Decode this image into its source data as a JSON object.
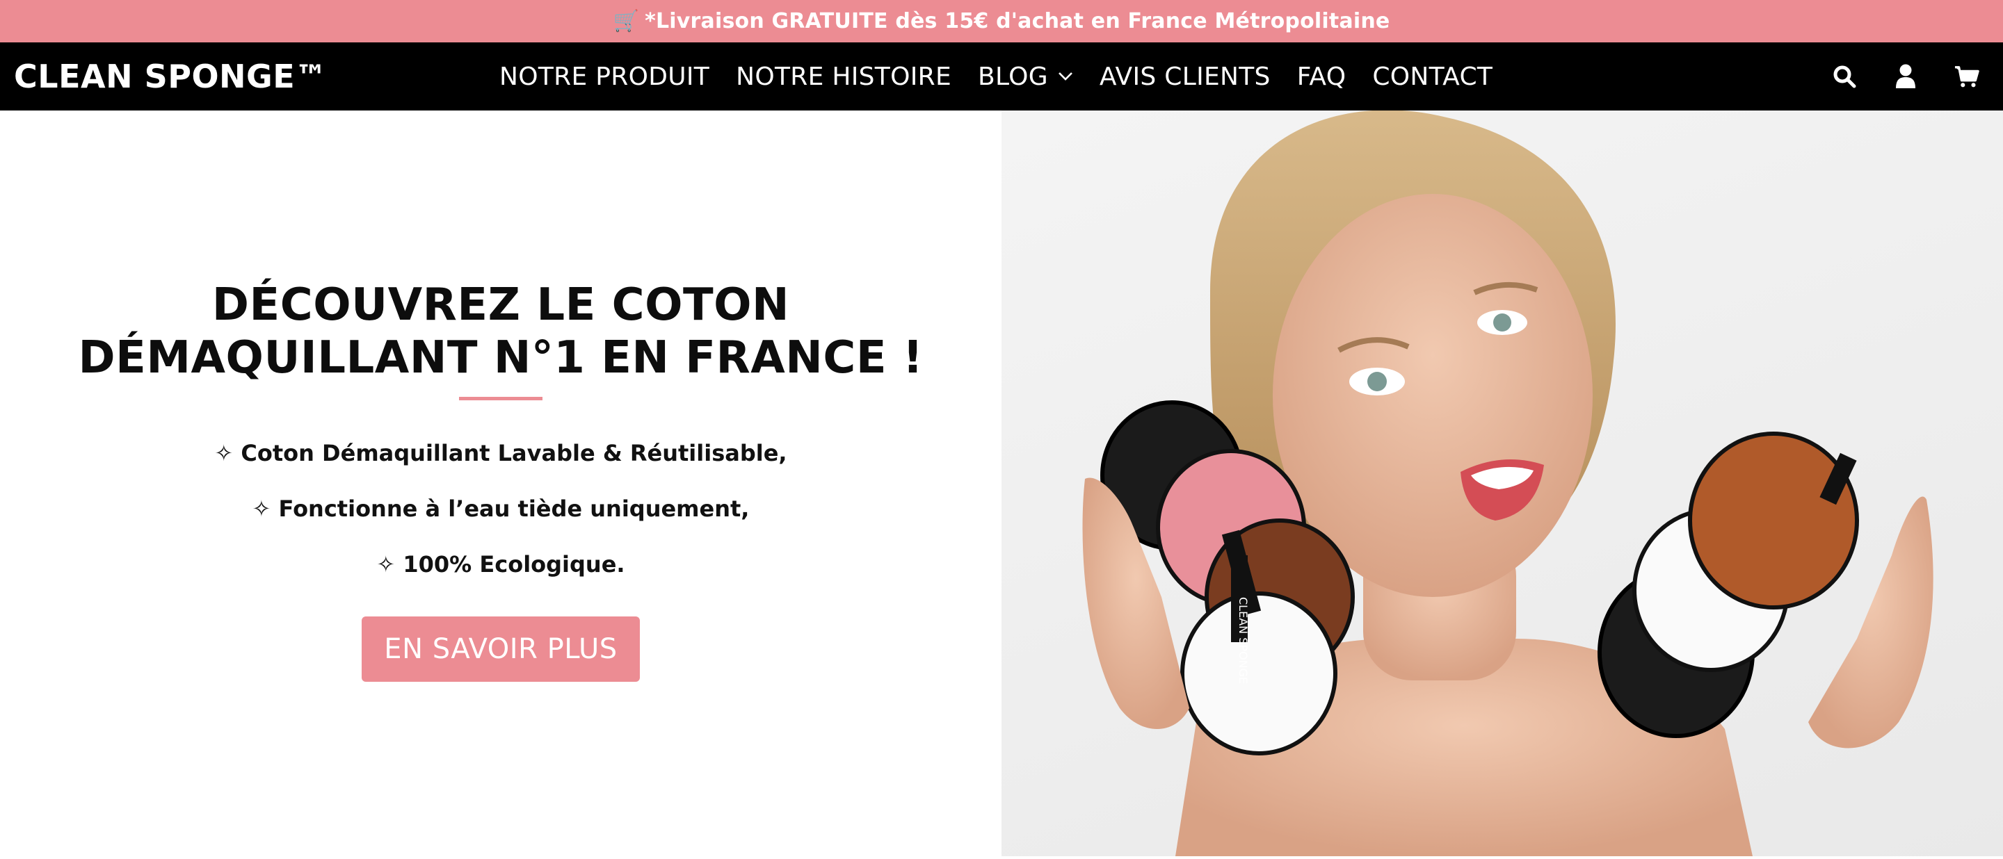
{
  "announcement": {
    "icon": "shopping-cart-emoji",
    "text": "*Livraison GRATUITE dès 15€ d'achat en France Métropolitaine"
  },
  "header": {
    "logo": "CLEAN SPONGE™",
    "menu": [
      {
        "label": "NOTRE PRODUIT"
      },
      {
        "label": "NOTRE HISTOIRE"
      },
      {
        "label": "BLOG",
        "has_dropdown": true
      },
      {
        "label": "AVIS CLIENTS"
      },
      {
        "label": "FAQ"
      },
      {
        "label": "CONTACT"
      }
    ],
    "icons": [
      "search-icon",
      "account-icon",
      "cart-icon"
    ]
  },
  "hero": {
    "title_line1": "DÉCOUVREZ LE COTON",
    "title_line2": "DÉMAQUILLANT N°1 EN FRANCE !",
    "features": [
      "✧ Coton Démaquillant Lavable & Réutilisable,",
      "✧ Fonctionne à l’eau tiède uniquement,",
      "✧ 100% Ecologique."
    ],
    "cta_label": "EN SAVOIR PLUS",
    "image_pad_text": "CLEAN SPONGE"
  },
  "colors": {
    "accent_pink": "#ec8c93",
    "nav_background": "#000000",
    "text": "#111111"
  }
}
